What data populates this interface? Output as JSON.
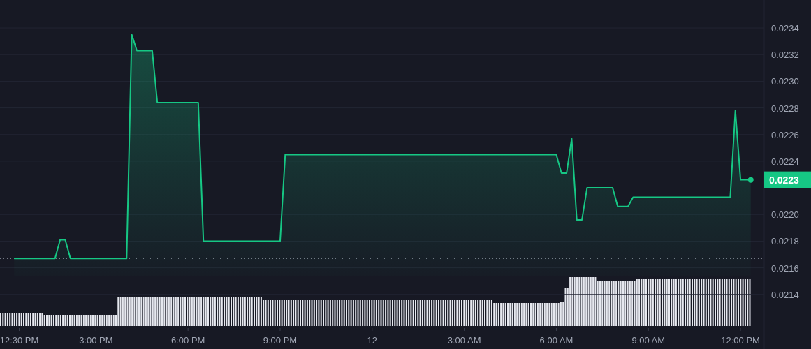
{
  "chart_data": {
    "type": "area",
    "grid": true,
    "categories": [
      null,
      "12:30 PM",
      null,
      null,
      null,
      null,
      null,
      null,
      null,
      null,
      null,
      null,
      null,
      null,
      null,
      null,
      "3:00 PM",
      null,
      null,
      null,
      null,
      null,
      null,
      null,
      null,
      null,
      null,
      null,
      null,
      null,
      null,
      null,
      null,
      null,
      "6:00 PM",
      null,
      null,
      null,
      null,
      null,
      null,
      null,
      null,
      null,
      null,
      null,
      null,
      null,
      null,
      null,
      null,
      null,
      "9:00 PM",
      null,
      null,
      null,
      null,
      null,
      null,
      null,
      null,
      null,
      null,
      null,
      null,
      null,
      null,
      null,
      null,
      null,
      "12",
      null,
      null,
      null,
      null,
      null,
      null,
      null,
      null,
      null,
      null,
      null,
      null,
      null,
      null,
      null,
      null,
      null,
      "3:00 AM",
      null,
      null,
      null,
      null,
      null,
      null,
      null,
      null,
      null,
      null,
      null,
      null,
      null,
      null,
      null,
      null,
      null,
      "6:00 AM",
      null,
      null,
      null,
      null,
      null,
      null,
      null,
      null,
      null,
      null,
      null,
      null,
      null,
      null,
      null,
      null,
      null,
      "9:00 AM",
      null,
      null,
      null,
      null,
      null,
      null,
      null,
      null,
      null,
      null,
      null,
      null,
      null,
      null,
      null,
      null,
      null,
      "12:00 PM",
      null,
      null
    ],
    "series": [
      {
        "color": "#16c784",
        "values": [
          0.02167,
          0.02167,
          0.02167,
          0.02167,
          0.02167,
          0.02167,
          0.02167,
          0.02167,
          0.02167,
          0.02181,
          0.02181,
          0.02167,
          0.02167,
          0.02167,
          0.02167,
          0.02167,
          0.02167,
          0.02167,
          0.02167,
          0.02167,
          0.02167,
          0.02167,
          0.02167,
          0.02335,
          0.02323,
          0.02323,
          0.02323,
          0.02323,
          0.02284,
          0.02284,
          0.02284,
          0.02284,
          0.02284,
          0.02284,
          0.02284,
          0.02284,
          0.02284,
          0.0218,
          0.0218,
          0.0218,
          0.0218,
          0.0218,
          0.0218,
          0.0218,
          0.0218,
          0.0218,
          0.0218,
          0.0218,
          0.0218,
          0.0218,
          0.0218,
          0.0218,
          0.0218,
          0.02245,
          0.02245,
          0.02245,
          0.02245,
          0.02245,
          0.02245,
          0.02245,
          0.02245,
          0.02245,
          0.02245,
          0.02245,
          0.02245,
          0.02245,
          0.02245,
          0.02245,
          0.02245,
          0.02245,
          0.02245,
          0.02245,
          0.02245,
          0.02245,
          0.02245,
          0.02245,
          0.02245,
          0.02245,
          0.02245,
          0.02245,
          0.02245,
          0.02245,
          0.02245,
          0.02245,
          0.02245,
          0.02245,
          0.02245,
          0.02245,
          0.02245,
          0.02245,
          0.02245,
          0.02245,
          0.02245,
          0.02245,
          0.02245,
          0.02245,
          0.02245,
          0.02245,
          0.02245,
          0.02245,
          0.02245,
          0.02245,
          0.02245,
          0.02245,
          0.02245,
          0.02245,
          0.02245,
          0.02231,
          0.02231,
          0.02257,
          0.02196,
          0.02196,
          0.0222,
          0.0222,
          0.0222,
          0.0222,
          0.0222,
          0.0222,
          0.02206,
          0.02206,
          0.02206,
          0.02213,
          0.02213,
          0.02213,
          0.02213,
          0.02213,
          0.02213,
          0.02213,
          0.02213,
          0.02213,
          0.02213,
          0.02213,
          0.02213,
          0.02213,
          0.02213,
          0.02213,
          0.02213,
          0.02213,
          0.02213,
          0.02213,
          0.02213,
          0.02278,
          0.02226,
          0.02226,
          0.02226
        ]
      }
    ],
    "ylim": [
      0.02099,
      0.02361
    ],
    "yticks": [
      {
        "value": 0.0214,
        "label": "0.0214"
      },
      {
        "value": 0.0216,
        "label": "0.0216"
      },
      {
        "value": 0.0218,
        "label": "0.0218"
      },
      {
        "value": 0.022,
        "label": "0.0220"
      },
      {
        "value": 0.0224,
        "label": "0.0224"
      },
      {
        "value": 0.0226,
        "label": "0.0226"
      },
      {
        "value": 0.0228,
        "label": "0.0228"
      },
      {
        "value": 0.023,
        "label": "0.0230"
      },
      {
        "value": 0.0232,
        "label": "0.0232"
      },
      {
        "value": 0.0234,
        "label": "0.0234"
      }
    ]
  },
  "current_price": {
    "label": "0.0223"
  }
}
